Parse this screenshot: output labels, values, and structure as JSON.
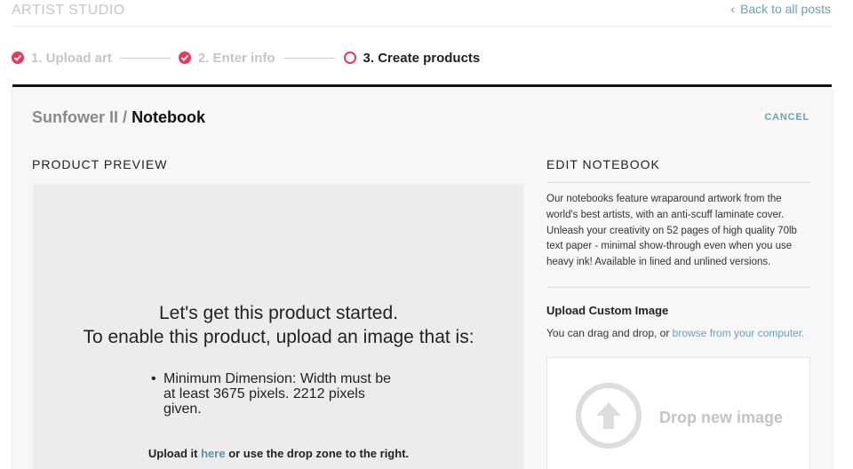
{
  "brand": "ARTIST STUDIO",
  "back_link": "Back to all posts",
  "steps": [
    {
      "label": "1. Upload art",
      "state": "done"
    },
    {
      "label": "2. Enter info",
      "state": "done"
    },
    {
      "label": "3. Create products",
      "state": "current"
    }
  ],
  "breadcrumb": {
    "artwork": "Sunfower II",
    "separator": "/",
    "product": "Notebook"
  },
  "cancel": "CANCEL",
  "preview": {
    "title": "PRODUCT PREVIEW",
    "prompt_line1": "Let's get this product started.",
    "prompt_line2": "To enable this product, upload an image that is:",
    "requirements": [
      "Minimum Dimension: Width must be at least 3675 pixels. 2212 pixels given."
    ],
    "upload_prefix": "Upload it",
    "upload_link": "here",
    "upload_suffix": "or use the drop zone to the right."
  },
  "edit": {
    "title": "EDIT NOTEBOOK",
    "description": "Our notebooks feature wraparound artwork from the world's best artists, with an anti-scuff laminate cover. Unleash your creativity on 52 pages of high quality 70lb text paper - minimal show-through even when you use heavy ink! Available in lined and unlined versions.",
    "custom_title": "Upload Custom Image",
    "custom_help_prefix": "You can drag and drop, or",
    "custom_help_link": "browse from your computer.",
    "drop_text": "Drop new image"
  },
  "colors": {
    "accent": "#e8385e",
    "link": "#6fa0b3",
    "muted": "#c6c6c6"
  },
  "icons": {
    "step_done": "check-circle-icon",
    "step_current": "ring-icon",
    "back": "chevron-left-icon",
    "upload": "upload-arrow-icon"
  }
}
